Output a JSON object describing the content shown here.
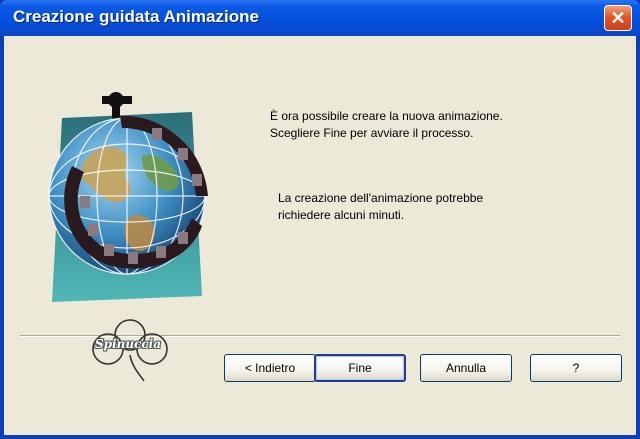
{
  "window": {
    "title": "Creazione guidata Animazione",
    "close_glyph": "✕"
  },
  "content": {
    "message_line1": "È ora possibile creare la nuova animazione.",
    "message_line2": "Scegliere Fine per avviare il processo.",
    "note_line1": "La creazione dell'animazione potrebbe",
    "note_line2": "richiedere alcuni minuti.",
    "artwork_icon": "globe-film-reel-icon"
  },
  "logo": {
    "text": "Spinuccia"
  },
  "buttons": {
    "back": "< Indietro",
    "finish": "Fine",
    "cancel": "Annulla",
    "help": "?"
  },
  "colors": {
    "titlebar": "#0350dc",
    "close_button": "#e2572b",
    "dialog_background": "#ece9d8"
  }
}
